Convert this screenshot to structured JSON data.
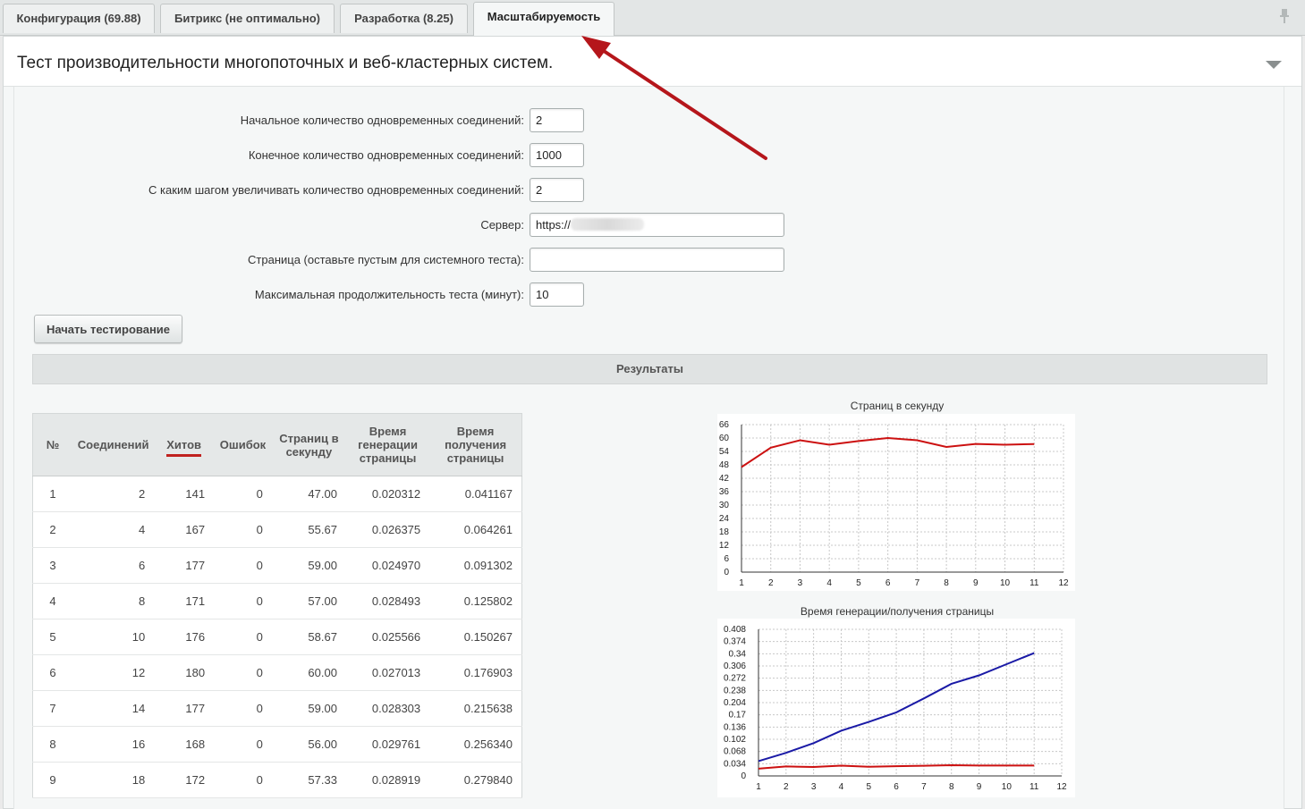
{
  "tabs": [
    {
      "label": "Конфигурация (69.88)"
    },
    {
      "label": "Битрикс (не оптимально)"
    },
    {
      "label": "Разработка (8.25)"
    },
    {
      "label": "Масштабируемость",
      "active": true
    }
  ],
  "panel": {
    "title": "Тест производительности многопоточных и веб-кластерных систем."
  },
  "form": {
    "start_connections_label": "Начальное количество одновременных соединений:",
    "start_connections_value": "2",
    "end_connections_label": "Конечное количество одновременных соединений:",
    "end_connections_value": "1000",
    "step_label": "С каким шагом увеличивать количество одновременных соединений:",
    "step_value": "2",
    "server_label": "Сервер:",
    "server_value": "https://",
    "page_label": "Страница (оставьте пустым для системного теста):",
    "page_value": "",
    "duration_label": "Максимальная продолжительность теста (минут):",
    "duration_value": "10",
    "start_button": "Начать тестирование"
  },
  "results": {
    "header": "Результаты",
    "columns": [
      "№",
      "Соединений",
      "Хитов",
      "Ошибок",
      "Страниц в секунду",
      "Время генерации страницы",
      "Время получения страницы"
    ],
    "rows": [
      [
        "1",
        "2",
        "141",
        "0",
        "47.00",
        "0.020312",
        "0.041167"
      ],
      [
        "2",
        "4",
        "167",
        "0",
        "55.67",
        "0.026375",
        "0.064261"
      ],
      [
        "3",
        "6",
        "177",
        "0",
        "59.00",
        "0.024970",
        "0.091302"
      ],
      [
        "4",
        "8",
        "171",
        "0",
        "57.00",
        "0.028493",
        "0.125802"
      ],
      [
        "5",
        "10",
        "176",
        "0",
        "58.67",
        "0.025566",
        "0.150267"
      ],
      [
        "6",
        "12",
        "180",
        "0",
        "60.00",
        "0.027013",
        "0.176903"
      ],
      [
        "7",
        "14",
        "177",
        "0",
        "59.00",
        "0.028303",
        "0.215638"
      ],
      [
        "8",
        "16",
        "168",
        "0",
        "56.00",
        "0.029761",
        "0.256340"
      ],
      [
        "9",
        "18",
        "172",
        "0",
        "57.33",
        "0.028919",
        "0.279840"
      ]
    ]
  },
  "chart_data": [
    {
      "type": "line",
      "title": "Страниц в секунду",
      "x": [
        1,
        2,
        3,
        4,
        5,
        6,
        7,
        8,
        9,
        10,
        11
      ],
      "xticks": [
        "1",
        "2",
        "3",
        "4",
        "5",
        "6",
        "7",
        "8",
        "9",
        "10",
        "11",
        "12"
      ],
      "yticks": [
        "0",
        "6",
        "12",
        "18",
        "24",
        "30",
        "36",
        "42",
        "48",
        "54",
        "60",
        "66"
      ],
      "xlim": [
        1,
        12
      ],
      "ylim": [
        0,
        66
      ],
      "grid": true,
      "series": [
        {
          "color": "#cc1111",
          "values": [
            47.0,
            55.67,
            59.0,
            57.0,
            58.67,
            60.0,
            59.0,
            56.0,
            57.33,
            57.0,
            57.3
          ]
        }
      ]
    },
    {
      "type": "line",
      "title": "Время генерации/получения страницы",
      "x": [
        1,
        2,
        3,
        4,
        5,
        6,
        7,
        8,
        9,
        10,
        11
      ],
      "xticks": [
        "1",
        "2",
        "3",
        "4",
        "5",
        "6",
        "7",
        "8",
        "9",
        "10",
        "11",
        "12"
      ],
      "yticks": [
        "0",
        "0.034",
        "0.068",
        "0.102",
        "0.136",
        "0.17",
        "0.204",
        "0.238",
        "0.272",
        "0.306",
        "0.34",
        "0.374",
        "0.408"
      ],
      "xlim": [
        1,
        12
      ],
      "ylim": [
        0,
        0.408
      ],
      "grid": true,
      "series": [
        {
          "color": "#1a1aa6",
          "values": [
            0.041167,
            0.064261,
            0.091302,
            0.125802,
            0.150267,
            0.176903,
            0.215638,
            0.25634,
            0.27984,
            0.311,
            0.342
          ]
        },
        {
          "color": "#cc1111",
          "values": [
            0.020312,
            0.026375,
            0.02497,
            0.028493,
            0.025566,
            0.027013,
            0.028303,
            0.029761,
            0.028919,
            0.029,
            0.029
          ]
        }
      ]
    }
  ]
}
